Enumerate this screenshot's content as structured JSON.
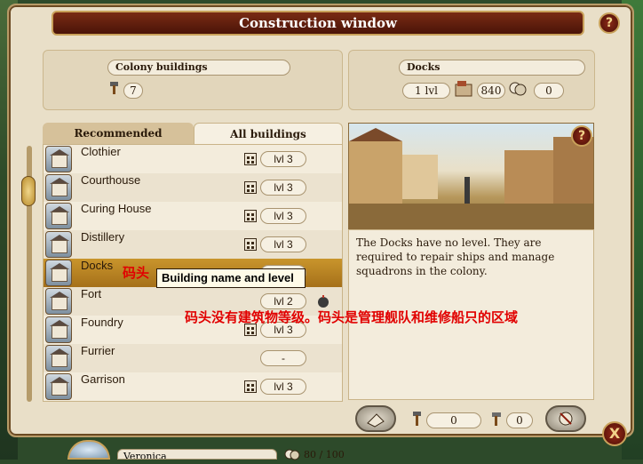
{
  "window": {
    "title": "Construction window",
    "help": "?",
    "close": "X"
  },
  "colony_box": {
    "label": "Colony buildings",
    "count": "7"
  },
  "selected_box": {
    "label": "Docks",
    "level": "1 lvl",
    "resource_value": "840",
    "culture_value": "0"
  },
  "tabs": {
    "recommended": "Recommended",
    "all": "All buildings"
  },
  "buildings": [
    {
      "name": "Clothier",
      "level": "lvl 3"
    },
    {
      "name": "Courthouse",
      "level": "lvl 3"
    },
    {
      "name": "Curing House",
      "level": "lvl 3"
    },
    {
      "name": "Distillery",
      "level": "lvl 3"
    },
    {
      "name": "Docks",
      "level": ""
    },
    {
      "name": "Fort",
      "level": "lvl 2"
    },
    {
      "name": "Foundry",
      "level": "lvl 3"
    },
    {
      "name": "Furrier",
      "level": "-"
    },
    {
      "name": "Garrison",
      "level": "lvl 3"
    }
  ],
  "description": "The Docks have no level. They are required to repair ships and manage squadrons in the colony.",
  "bottom": {
    "left_value": "0",
    "right_value": "0"
  },
  "tooltip": "Building name and level",
  "annotations": {
    "docks_cn": "码头",
    "note_cn": "码头没有建筑物等级。码头是管理舰队和维修船只的区域"
  },
  "footer": {
    "name": "Veronica",
    "counter": "80 / 100"
  }
}
